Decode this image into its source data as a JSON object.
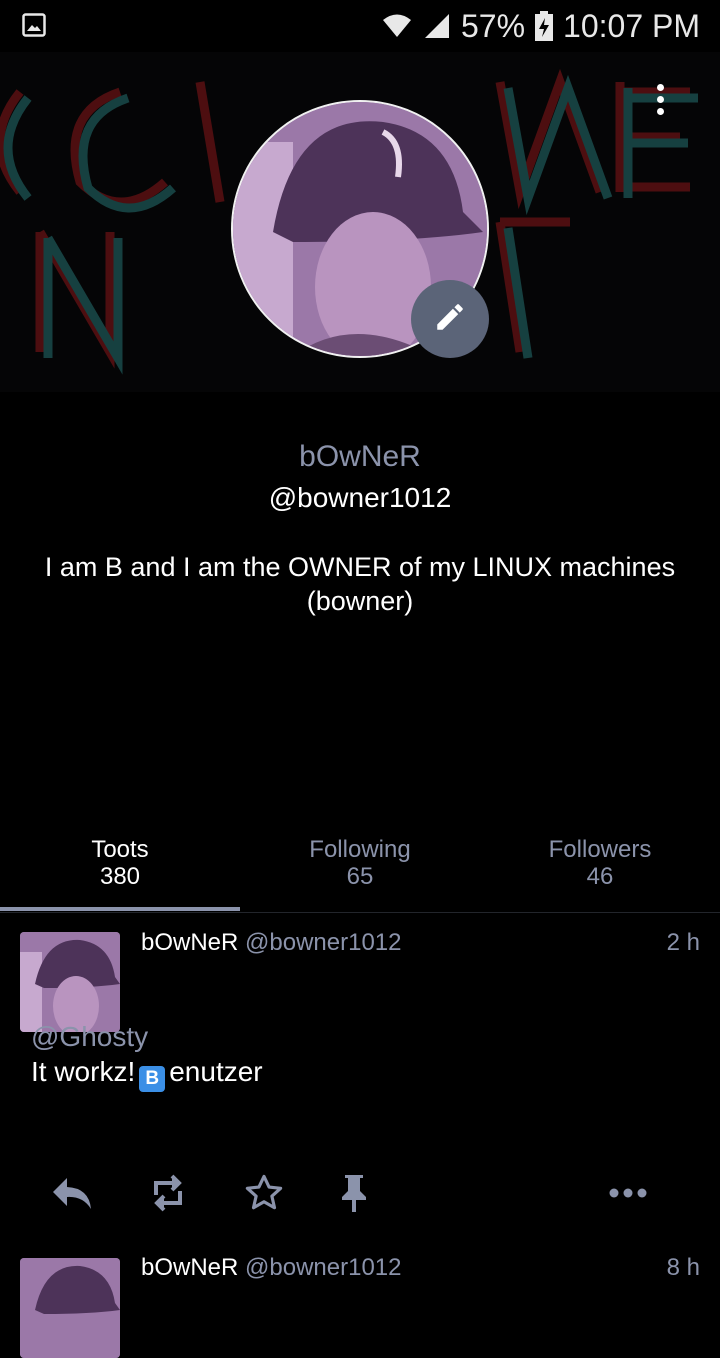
{
  "statusbar": {
    "battery": "57%",
    "time": "10:07 PM"
  },
  "profile": {
    "display_name": "bOwNeR",
    "handle": "@bowner1012",
    "bio": "I am B and I am the OWNER of my LINUX machines (bowner)"
  },
  "tabs": [
    {
      "label": "Toots",
      "count": "380",
      "active": true
    },
    {
      "label": "Following",
      "count": "65"
    },
    {
      "label": "Followers",
      "count": "46"
    }
  ],
  "statuses": [
    {
      "display_name": "bOwNeR",
      "acct": "@bowner1012",
      "time": "2 h",
      "mention": "@Ghosty",
      "text_before": "It workz!",
      "emoji": "B",
      "text_after": "enutzer"
    },
    {
      "display_name": "bOwNeR",
      "acct": "@bowner1012",
      "time": "8 h"
    }
  ],
  "colors": {
    "accent": "#8b93ab",
    "edit_button": "#5b6478",
    "background": "#000000"
  }
}
